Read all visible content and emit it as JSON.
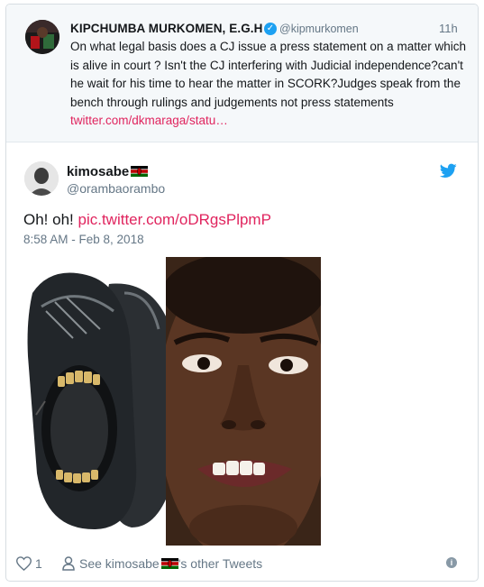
{
  "quoted_tweet": {
    "author_name": "KIPCHUMBA MURKOMEN, E.G.H",
    "handle": "@kipmurkomen",
    "time": "11h",
    "text": "On what legal basis does a CJ issue a press statement on a matter which is alive in court ? Isn't the CJ interfering with Judicial independence?can't he wait for his time to hear the matter in SCORK?Judges speak from the bench through rulings and judgements not press statements ",
    "link": "twitter.com/dkmaraga/statu…"
  },
  "tweet": {
    "author_name": "kimosabe",
    "handle": "@orambaorambo",
    "text_prefix": "Oh! oh! ",
    "link": "pic.twitter.com/oDRgsPlpmP",
    "date": "8:58 AM - Feb 8, 2018"
  },
  "actions": {
    "like_count": "1",
    "see_prefix": "See kimosabe",
    "see_suffix": "'s other Tweets"
  },
  "colors": {
    "link": "#e0245e",
    "twitter_blue": "#1da1f2",
    "muted": "#657786"
  },
  "icons": [
    "verified-icon",
    "twitter-bird-icon",
    "heart-icon",
    "person-icon",
    "info-icon",
    "kenya-flag-icon"
  ]
}
